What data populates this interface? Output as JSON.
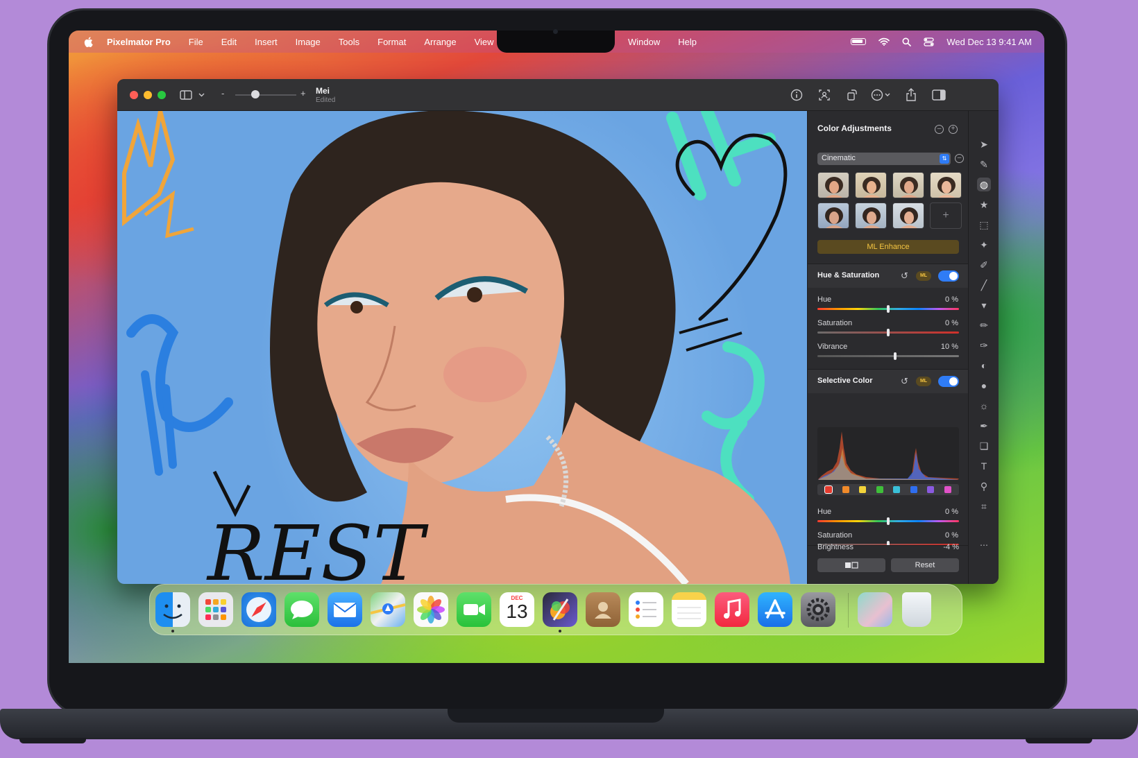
{
  "menubar": {
    "app_name": "Pixelmator Pro",
    "menus": [
      "File",
      "Edit",
      "Insert",
      "Image",
      "Tools",
      "Format",
      "Arrange",
      "View"
    ],
    "menus_right": [
      "Window",
      "Help"
    ],
    "datetime": "Wed Dec 13  9:41 AM"
  },
  "window": {
    "doc_title": "Mei",
    "doc_status": "Edited"
  },
  "panel": {
    "title": "Color Adjustments",
    "preset": "Cinematic",
    "ml_enhance": "ML Enhance",
    "ml_badge": "ML",
    "hue_saturation": {
      "title": "Hue & Saturation",
      "sliders": [
        {
          "label": "Hue",
          "value": "0 %",
          "level": 0.5
        },
        {
          "label": "Saturation",
          "value": "0 %",
          "level": 0.5
        },
        {
          "label": "Vibrance",
          "value": "10 %",
          "level": 0.55
        }
      ]
    },
    "selective_color": {
      "title": "Selective Color",
      "sliders": [
        {
          "label": "Hue",
          "value": "0 %",
          "level": 0.5
        },
        {
          "label": "Saturation",
          "value": "0 %",
          "level": 0.5
        },
        {
          "label": "Brightness",
          "value": "-4 %",
          "level": 0.48
        }
      ],
      "swatch_colors": [
        "#e53a2e",
        "#f08a2a",
        "#f2d33a",
        "#3fbf3a",
        "#3ac0d8",
        "#2f6ef0",
        "#8a5ae0",
        "#e052c8"
      ]
    },
    "reset_label": "Reset"
  },
  "canvas_text": {
    "bottom_scribble": "REST"
  },
  "dock": {
    "calendar_month": "DEC",
    "calendar_day": "13"
  },
  "colors": {
    "accent": "#2f7cf6",
    "ml_gold": "#f5c542",
    "traffic_red": "#ff5f57",
    "traffic_yellow": "#febc2e",
    "traffic_green": "#28c840"
  }
}
